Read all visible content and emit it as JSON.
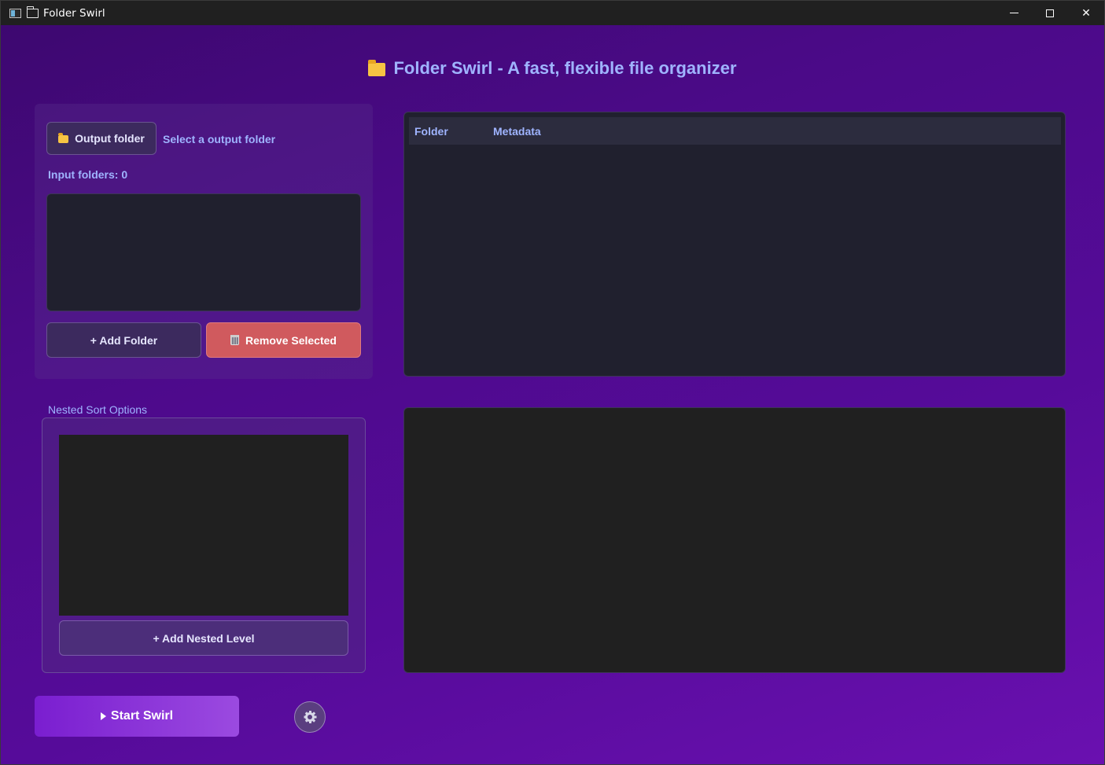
{
  "window": {
    "title": "Folder Swirl",
    "controls": {
      "minimize": "minimize",
      "maximize": "maximize",
      "close": "✕"
    }
  },
  "header": {
    "title": "Folder Swirl - A fast, flexible file organizer",
    "icon": "folder-icon"
  },
  "input_panel": {
    "output_button_label": "Output folder",
    "output_status": "Select a output folder",
    "input_count_label": "Input folders: 0",
    "add_folder_label": "+ Add Folder",
    "remove_selected_label": "Remove Selected",
    "remove_color": "#d05a5e"
  },
  "nested": {
    "label": "Nested Sort Options",
    "add_level_label": "+ Add Nested Level"
  },
  "table": {
    "columns": [
      "Folder",
      "Metadata"
    ]
  },
  "footer": {
    "start_label": "Start Swirl",
    "start_colors": [
      "#7a1ed0",
      "#9b4ae0"
    ],
    "settings_icon": "gear-icon"
  },
  "theme": {
    "accent_text": "#9fb4ff",
    "background": "#4b0a88"
  }
}
